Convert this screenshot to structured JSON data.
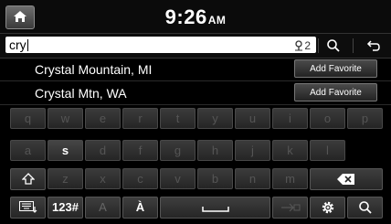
{
  "header": {
    "time": "9:26",
    "ampm": "AM"
  },
  "search": {
    "query": "cry",
    "voice_badge": "2"
  },
  "results": [
    {
      "name": "Crystal Mountain, MI",
      "action": "Add Favorite"
    },
    {
      "name": "Crystal Mtn, WA",
      "action": "Add Favorite"
    }
  ],
  "keyboard": {
    "row1": [
      "q",
      "w",
      "e",
      "r",
      "t",
      "y",
      "u",
      "i",
      "o",
      "p"
    ],
    "row2": [
      "a",
      "s",
      "d",
      "f",
      "g",
      "h",
      "j",
      "k",
      "l"
    ],
    "row3": [
      "z",
      "x",
      "c",
      "v",
      "b",
      "n",
      "m"
    ],
    "active_key": "s",
    "bottom": {
      "numbers": "123#",
      "case": "A",
      "accent": "À"
    }
  }
}
